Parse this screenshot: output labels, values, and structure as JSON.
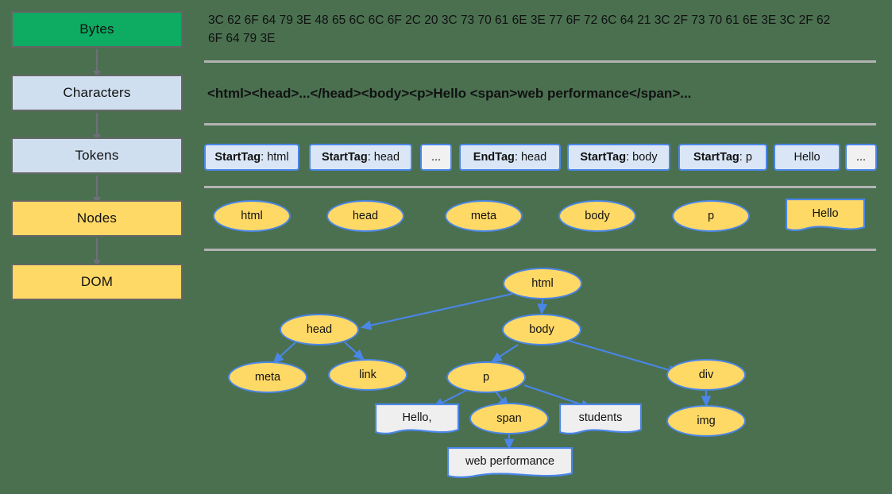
{
  "colors": {
    "background": "#4a7050",
    "bytes_box": "#0eab63",
    "blue_box": "#cfdfef",
    "yellow_box": "#ffd966",
    "node_border": "#4a86e8",
    "separator": "#b3b3b3",
    "text_node_fill": "#efefef"
  },
  "pipeline": {
    "steps": [
      {
        "label": "Bytes"
      },
      {
        "label": "Characters"
      },
      {
        "label": "Tokens"
      },
      {
        "label": "Nodes"
      },
      {
        "label": "DOM"
      }
    ]
  },
  "bytes_row": {
    "text": "3C 62 6F 64 79 3E 48 65 6C 6C 6F 2C 20 3C 73 70 61 6E 3E 77 6F 72 6C 64 21 3C 2F 73 70 61 6E 3E 3C 2F 62 6F 64 79 3E"
  },
  "characters_row": {
    "text": "<html><head>...</head><body><p>Hello <span>web performance</span>..."
  },
  "tokens_row": {
    "tokens": [
      {
        "kind": "StartTag",
        "value": "html",
        "style": "blue"
      },
      {
        "kind": "StartTag",
        "value": "head",
        "style": "blue"
      },
      {
        "kind": "",
        "value": "...",
        "style": "grey"
      },
      {
        "kind": "EndTag",
        "value": "head",
        "style": "blue"
      },
      {
        "kind": "StartTag",
        "value": "body",
        "style": "blue"
      },
      {
        "kind": "StartTag",
        "value": "p",
        "style": "blue"
      },
      {
        "kind": "",
        "value": "Hello",
        "style": "blue"
      },
      {
        "kind": "",
        "value": "...",
        "style": "grey"
      }
    ]
  },
  "nodes_row": {
    "nodes": [
      {
        "label": "html",
        "shape": "ellipse"
      },
      {
        "label": "head",
        "shape": "ellipse"
      },
      {
        "label": "meta",
        "shape": "ellipse"
      },
      {
        "label": "body",
        "shape": "ellipse"
      },
      {
        "label": "p",
        "shape": "ellipse"
      },
      {
        "label": "Hello",
        "shape": "text-node"
      }
    ]
  },
  "dom_tree": {
    "nodes": [
      {
        "id": "html",
        "label": "html",
        "shape": "ellipse"
      },
      {
        "id": "head",
        "label": "head",
        "shape": "ellipse"
      },
      {
        "id": "body",
        "label": "body",
        "shape": "ellipse"
      },
      {
        "id": "meta",
        "label": "meta",
        "shape": "ellipse"
      },
      {
        "id": "link",
        "label": "link",
        "shape": "ellipse"
      },
      {
        "id": "p",
        "label": "p",
        "shape": "ellipse"
      },
      {
        "id": "div",
        "label": "div",
        "shape": "ellipse"
      },
      {
        "id": "hello",
        "label": "Hello,",
        "shape": "text-node"
      },
      {
        "id": "span",
        "label": "span",
        "shape": "ellipse"
      },
      {
        "id": "students",
        "label": "students",
        "shape": "text-node"
      },
      {
        "id": "img",
        "label": "img",
        "shape": "ellipse"
      },
      {
        "id": "webperf",
        "label": "web performance",
        "shape": "text-node"
      }
    ],
    "edges": [
      {
        "from": "html",
        "to": "head"
      },
      {
        "from": "html",
        "to": "body"
      },
      {
        "from": "head",
        "to": "meta"
      },
      {
        "from": "head",
        "to": "link"
      },
      {
        "from": "body",
        "to": "p"
      },
      {
        "from": "body",
        "to": "div"
      },
      {
        "from": "p",
        "to": "hello"
      },
      {
        "from": "p",
        "to": "span"
      },
      {
        "from": "p",
        "to": "students"
      },
      {
        "from": "div",
        "to": "img"
      },
      {
        "from": "span",
        "to": "webperf"
      }
    ]
  }
}
